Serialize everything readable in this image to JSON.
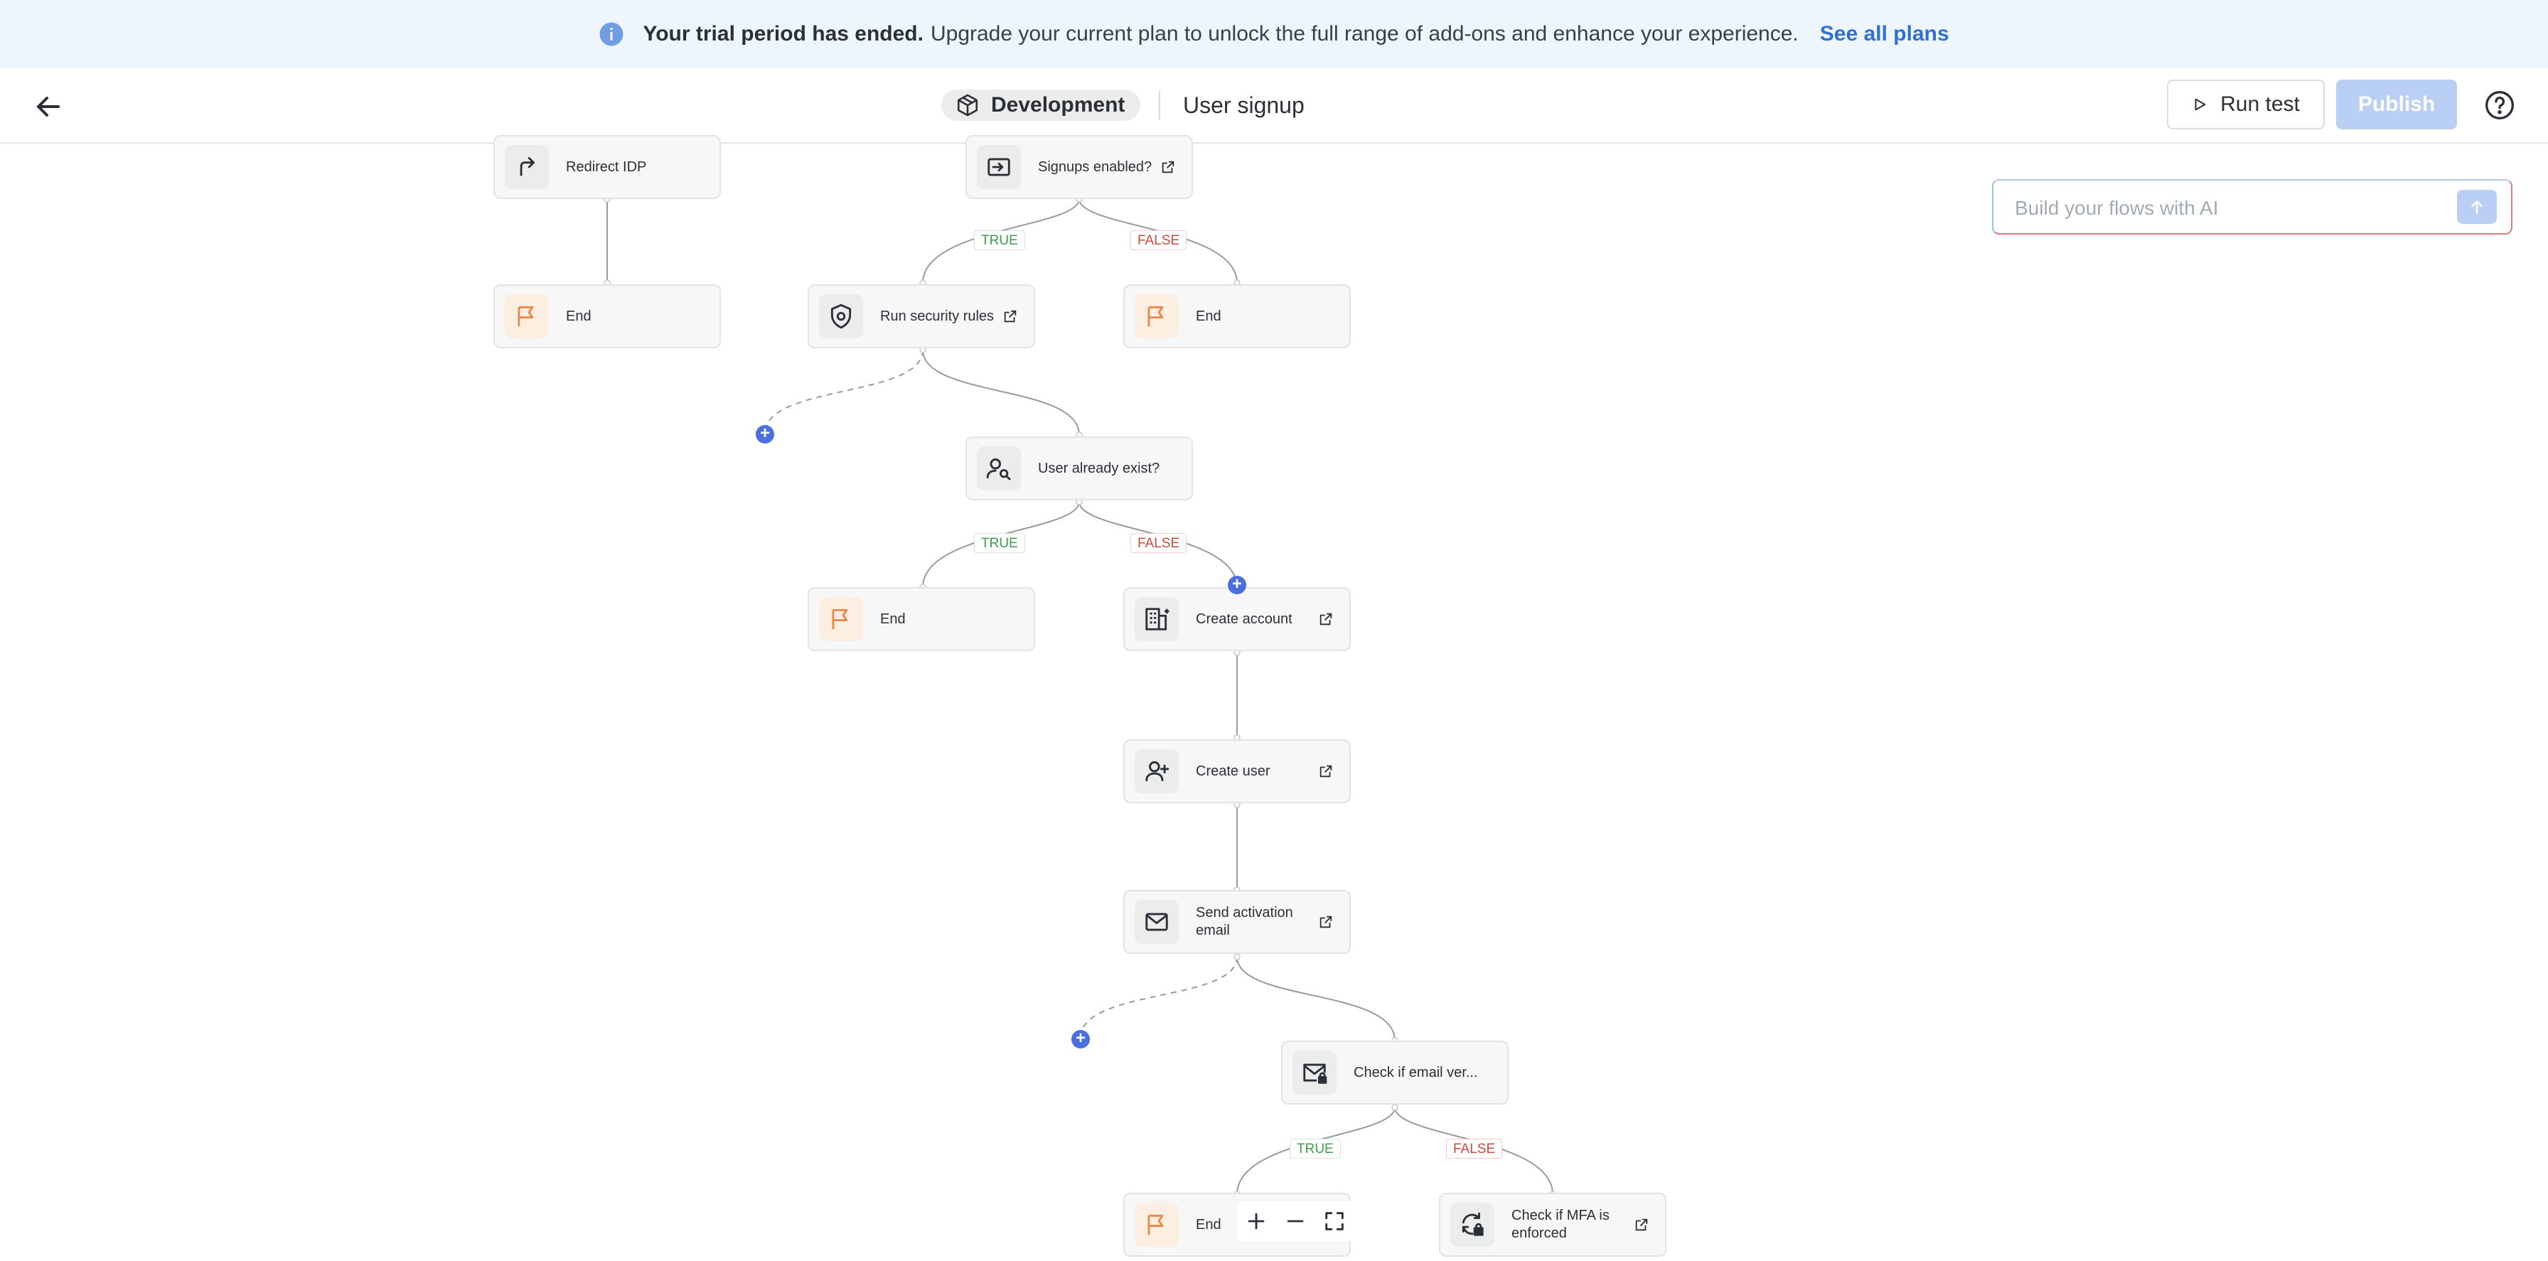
{
  "banner": {
    "strong": "Your trial period has ended.",
    "text": "Upgrade your current plan to unlock the full range of add-ons and enhance your experience.",
    "link": "See all plans",
    "icon": "info-icon"
  },
  "header": {
    "environment": "Development",
    "flow_name": "User signup",
    "run_test": "Run test",
    "publish": "Publish"
  },
  "ai": {
    "placeholder": "Build your flows with AI"
  },
  "colors": {
    "accent": "#4b6fe0",
    "true": "#3f9e4c",
    "false": "#c94a3f",
    "publish_disabled": "#b9d0f4"
  },
  "nodes": {
    "redirect_idp": "Redirect IDP",
    "end_1": "End",
    "signups_enabled": "Signups enabled?",
    "run_security": "Run security rules",
    "end_2": "End",
    "user_exists": "User already exist?",
    "end_3": "End",
    "create_account": "Create account",
    "create_user": "Create user",
    "send_activation": "Send activation email",
    "check_email": "Check if email ver...",
    "end_4": "End",
    "check_mfa": "Check if MFA is enforced"
  },
  "branches": {
    "true_label": "TRUE",
    "false_label": "FALSE"
  }
}
